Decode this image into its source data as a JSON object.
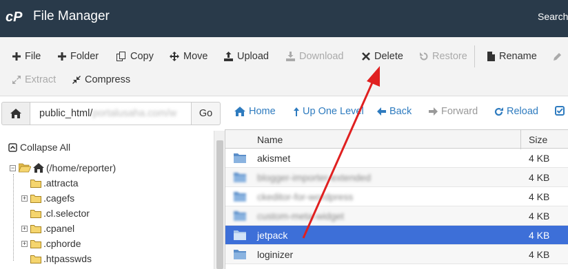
{
  "header": {
    "title": "File Manager",
    "search_label": "Search"
  },
  "toolbar": {
    "file": "File",
    "folder": "Folder",
    "copy": "Copy",
    "move": "Move",
    "upload": "Upload",
    "download": "Download",
    "delete": "Delete",
    "restore": "Restore",
    "rename": "Rename",
    "extract": "Extract",
    "compress": "Compress"
  },
  "pathbar": {
    "path_prefix": "public_html/",
    "path_hidden": "portalusaha.com/w",
    "go": "Go"
  },
  "nav": {
    "home": "Home",
    "up": "Up One Level",
    "back": "Back",
    "forward": "Forward",
    "reload": "Reload"
  },
  "tree": {
    "collapse": "Collapse All",
    "root": "(/home/reporter)",
    "items": [
      ".attracta",
      ".cagefs",
      ".cl.selector",
      ".cpanel",
      ".cphorde",
      ".htpasswds"
    ]
  },
  "files": {
    "col_name": "Name",
    "col_size": "Size",
    "rows": [
      {
        "name": "akismet",
        "size": "4 KB"
      },
      {
        "name": "blogger-importer-extended",
        "size": "4 KB"
      },
      {
        "name": "ckeditor-for-wordpress",
        "size": "4 KB"
      },
      {
        "name": "custom-meta-widget",
        "size": "4 KB"
      },
      {
        "name": "jetpack",
        "size": "4 KB"
      },
      {
        "name": "loginizer",
        "size": "4 KB"
      }
    ]
  },
  "colors": {
    "header": "#293a4a",
    "link": "#2e7bbf",
    "selected": "#3d6fd8",
    "annotation": "#e02020"
  }
}
